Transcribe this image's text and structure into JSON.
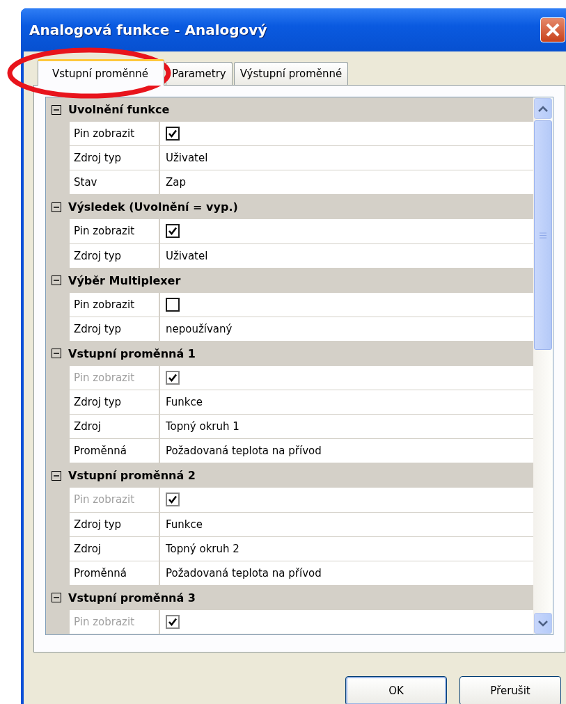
{
  "window": {
    "title": "Analogová funkce - Analogový"
  },
  "tabs": [
    {
      "label": "Vstupní proměnné",
      "selected": true,
      "highlighted": true
    },
    {
      "label": "Parametry",
      "selected": false,
      "highlighted": false
    },
    {
      "label": "Výstupní proměnné",
      "selected": false,
      "highlighted": false
    }
  ],
  "property_grid": {
    "groups": [
      {
        "title": "Uvolnění funkce",
        "expanded": true,
        "items": [
          {
            "label": "Pin zobrazit",
            "kind": "checkbox",
            "checked": true,
            "disabled": false
          },
          {
            "label": "Zdroj typ",
            "kind": "text",
            "value": "Uživatel",
            "disabled": false
          },
          {
            "label": "Stav",
            "kind": "text",
            "value": "Zap",
            "disabled": false
          }
        ]
      },
      {
        "title": "Výsledek (Uvolnění = vyp.)",
        "expanded": true,
        "items": [
          {
            "label": "Pin zobrazit",
            "kind": "checkbox",
            "checked": true,
            "disabled": false
          },
          {
            "label": "Zdroj typ",
            "kind": "text",
            "value": "Uživatel",
            "disabled": false
          }
        ]
      },
      {
        "title": "Výběr Multiplexer",
        "expanded": true,
        "items": [
          {
            "label": "Pin zobrazit",
            "kind": "checkbox",
            "checked": false,
            "disabled": false
          },
          {
            "label": "Zdroj typ",
            "kind": "text",
            "value": "nepoužívaný",
            "disabled": false
          }
        ]
      },
      {
        "title": "Vstupní proměnná 1",
        "expanded": true,
        "items": [
          {
            "label": "Pin zobrazit",
            "kind": "checkbox",
            "checked": true,
            "disabled": true
          },
          {
            "label": "Zdroj typ",
            "kind": "text",
            "value": "Funkce",
            "disabled": false
          },
          {
            "label": "Zdroj",
            "kind": "text",
            "value": "Topný okruh 1",
            "disabled": false
          },
          {
            "label": "Proměnná",
            "kind": "text",
            "value": "Požadovaná teplota na přívod",
            "disabled": false
          }
        ]
      },
      {
        "title": "Vstupní proměnná 2",
        "expanded": true,
        "items": [
          {
            "label": "Pin zobrazit",
            "kind": "checkbox",
            "checked": true,
            "disabled": true
          },
          {
            "label": "Zdroj typ",
            "kind": "text",
            "value": "Funkce",
            "disabled": false
          },
          {
            "label": "Zdroj",
            "kind": "text",
            "value": "Topný okruh 2",
            "disabled": false
          },
          {
            "label": "Proměnná",
            "kind": "text",
            "value": "Požadovaná teplota na přívod",
            "disabled": false
          }
        ]
      },
      {
        "title": "Vstupní proměnná 3",
        "expanded": true,
        "items": [
          {
            "label": "Pin zobrazit",
            "kind": "checkbox",
            "checked": true,
            "disabled": true
          }
        ]
      }
    ]
  },
  "buttons": [
    {
      "label": "OK",
      "default": true
    },
    {
      "label": "Přerušit",
      "default": false
    }
  ]
}
